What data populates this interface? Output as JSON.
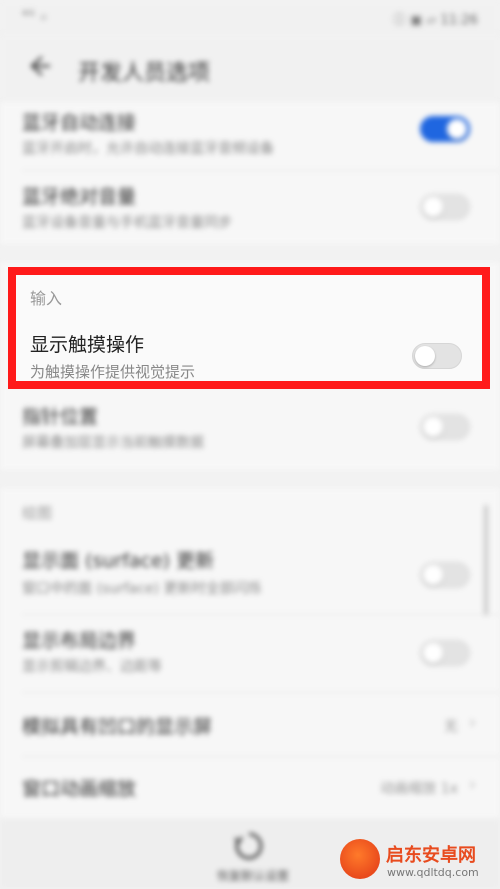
{
  "status_bar": {
    "signal": "⁴ᴳ ᵢₗ",
    "right": "ⓘ ▣ ▱ 11:26"
  },
  "appbar": {
    "title": "开发人员选项"
  },
  "items": {
    "bt_auto": {
      "title": "蓝牙自动连接",
      "subtitle": "蓝牙开启时，允许自动连接蓝牙音频设备",
      "toggle_on": true
    },
    "bt_abs_vol": {
      "title": "蓝牙绝对音量",
      "subtitle": "蓝牙设备音量与手机蓝牙音量同步",
      "toggle_on": false
    },
    "pointer": {
      "title": "指针位置",
      "subtitle": "屏幕叠加层显示当前触摸数据",
      "toggle_on": false
    },
    "surface": {
      "title": "显示面 (surface) 更新",
      "subtitle": "窗口中的面 (surface) 更新时全部闪烁",
      "toggle_on": false
    },
    "layout": {
      "title": "显示布局边界",
      "subtitle": "显示剪辑边界、边距等",
      "toggle_on": false
    },
    "secondary": {
      "title": "模拟具有凹口的显示屏",
      "value": "无"
    },
    "window_anim": {
      "title": "窗口动画缩放",
      "value": "动画缩放 1x"
    }
  },
  "sections": {
    "input": "输入",
    "drawing": "绘图"
  },
  "highlight": {
    "title": "显示触摸操作",
    "subtitle": "为触摸操作提供视觉提示",
    "toggle_on": false
  },
  "bottom": {
    "label": "恢复默认设置"
  },
  "watermark": {
    "title": "启东安卓网",
    "url": "www.qdltdq.com"
  }
}
